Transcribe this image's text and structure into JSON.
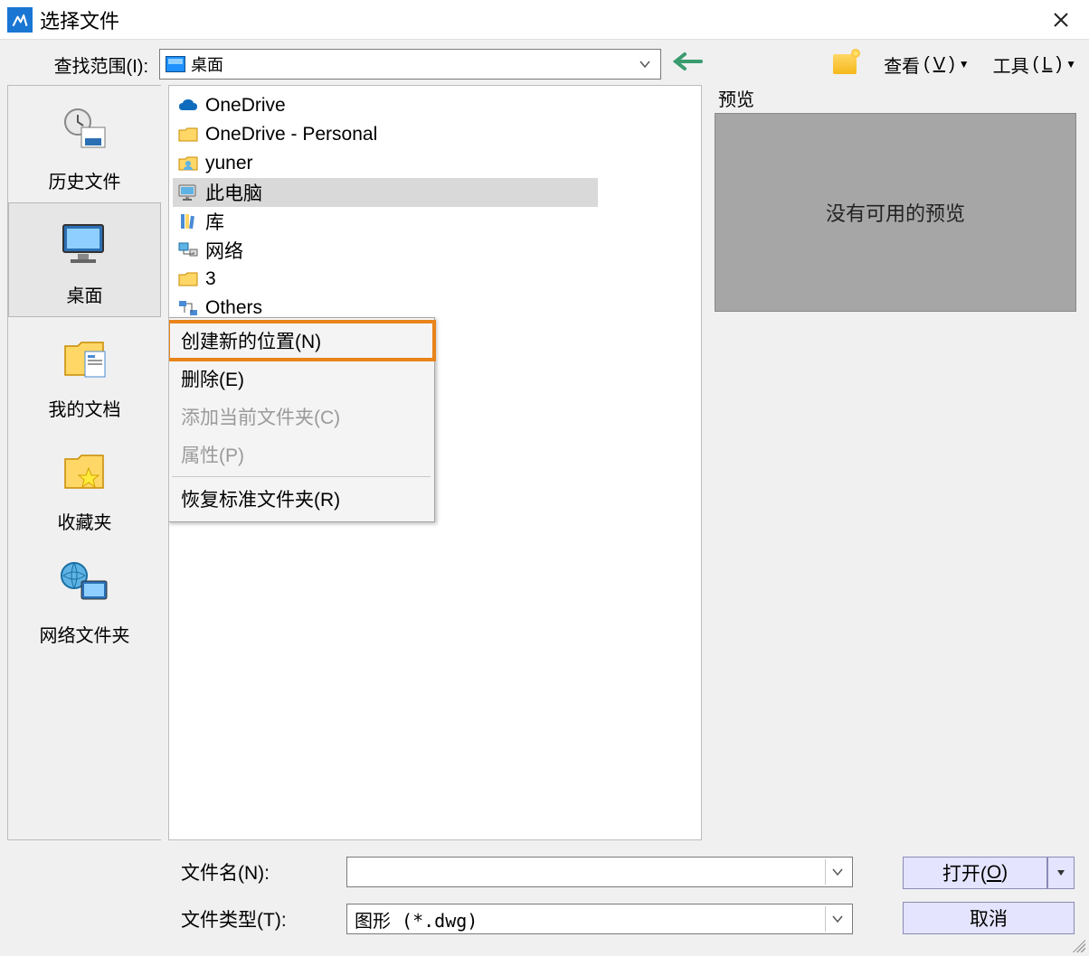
{
  "title": "选择文件",
  "lookin_label": "查找范围(I):",
  "lookin_value": "桌面",
  "toolbar": {
    "view": "查看",
    "view_key": "V",
    "tools": "工具",
    "tools_key": "L"
  },
  "sidebar": [
    {
      "label": "历史文件"
    },
    {
      "label": "桌面"
    },
    {
      "label": "我的文档"
    },
    {
      "label": "收藏夹"
    },
    {
      "label": "网络文件夹"
    }
  ],
  "files": [
    {
      "label": "OneDrive",
      "icon": "cloud"
    },
    {
      "label": "OneDrive - Personal",
      "icon": "folder"
    },
    {
      "label": "yuner",
      "icon": "user"
    },
    {
      "label": "此电脑",
      "icon": "pc",
      "selected": true
    },
    {
      "label": "库",
      "icon": "library"
    },
    {
      "label": "网络",
      "icon": "network"
    },
    {
      "label": "3",
      "icon": "folder"
    },
    {
      "label": "Others",
      "icon": "nodes"
    }
  ],
  "context_menu": [
    {
      "label": "创建新的位置(N)",
      "highlight": true
    },
    {
      "label": "删除(E)"
    },
    {
      "label": "添加当前文件夹(C)",
      "disabled": true
    },
    {
      "label": "属性(P)",
      "disabled": true
    },
    {
      "sep": true
    },
    {
      "label": "恢复标准文件夹(R)"
    }
  ],
  "preview": {
    "title": "预览",
    "empty": "没有可用的预览"
  },
  "filename_label": "文件名(N):",
  "filename_value": "",
  "filetype_label": "文件类型(T):",
  "filetype_value": "图形 (*.dwg)",
  "buttons": {
    "open": "打开(",
    "open_key": "O",
    "open_suffix": ")",
    "cancel": "取消"
  }
}
